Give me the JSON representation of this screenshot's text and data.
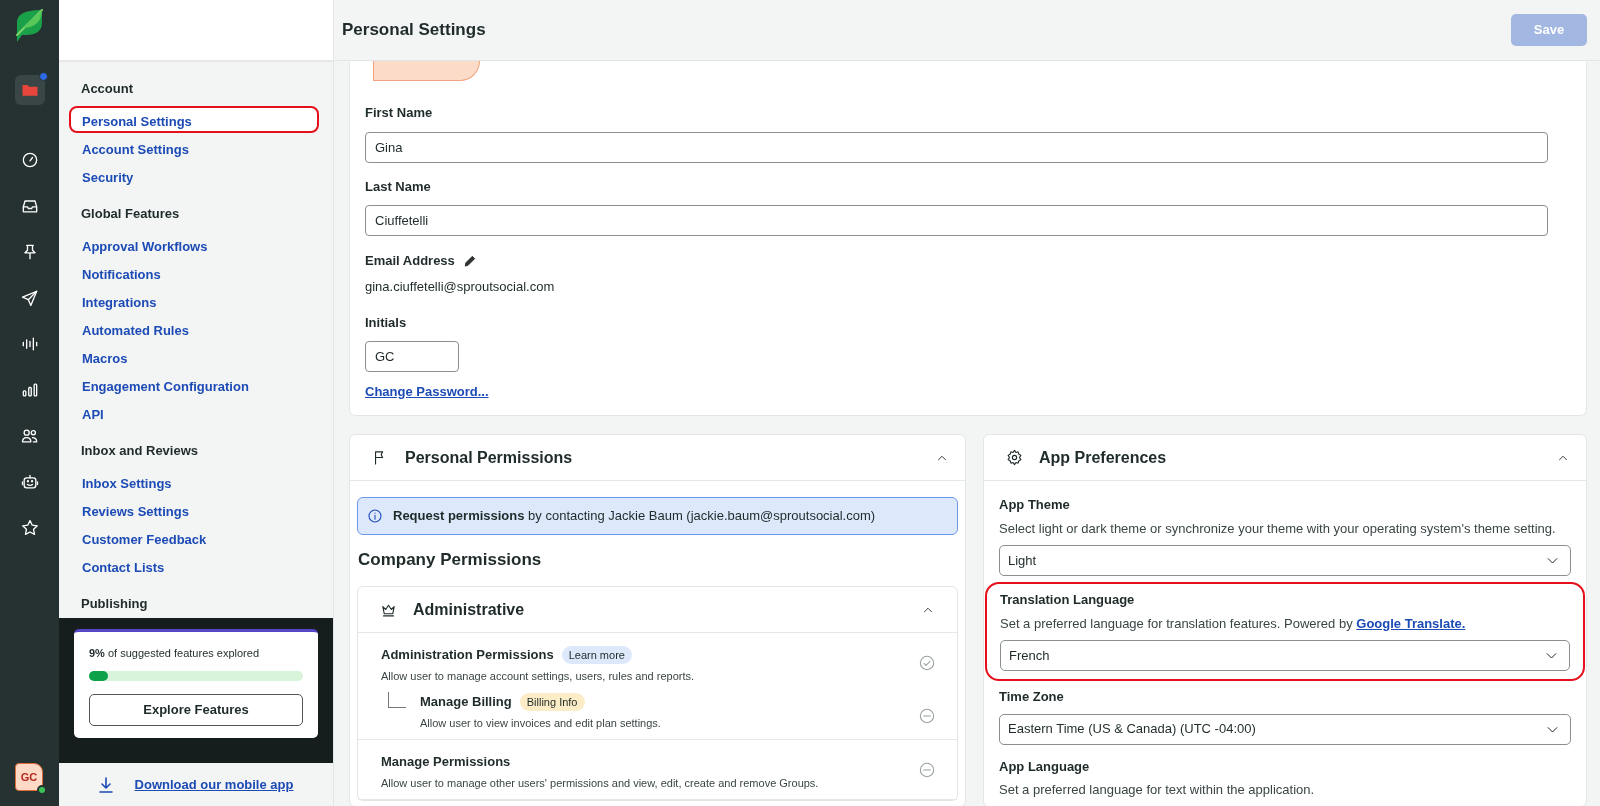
{
  "rail": {
    "items": [
      {
        "selected": true,
        "badge": true
      },
      {
        "selected": false,
        "badge": false
      },
      {
        "selected": false,
        "badge": false
      },
      {
        "selected": false,
        "badge": false
      },
      {
        "selected": false,
        "badge": false
      },
      {
        "selected": false,
        "badge": false
      },
      {
        "selected": false,
        "badge": false
      },
      {
        "selected": false,
        "badge": false
      },
      {
        "selected": false,
        "badge": false
      },
      {
        "selected": false,
        "badge": false
      }
    ],
    "avatar": {
      "initials": "GC",
      "online": true
    }
  },
  "sidebar": {
    "groups": [
      {
        "title": "Account",
        "items": [
          {
            "label": "Personal Settings",
            "selected": true,
            "highlighted": true
          },
          {
            "label": "Account Settings",
            "selected": false,
            "highlighted": false
          },
          {
            "label": "Security",
            "selected": false,
            "highlighted": false
          }
        ]
      },
      {
        "title": "Global Features",
        "items": [
          {
            "label": "Approval Workflows",
            "selected": false,
            "highlighted": false
          },
          {
            "label": "Notifications",
            "selected": false,
            "highlighted": false
          },
          {
            "label": "Integrations",
            "selected": false,
            "highlighted": false
          },
          {
            "label": "Automated Rules",
            "selected": false,
            "highlighted": false
          },
          {
            "label": "Macros",
            "selected": false,
            "highlighted": false
          },
          {
            "label": "Engagement Configuration",
            "selected": false,
            "highlighted": false
          },
          {
            "label": "API",
            "selected": false,
            "highlighted": false
          }
        ]
      },
      {
        "title": "Inbox and Reviews",
        "items": [
          {
            "label": "Inbox Settings",
            "selected": false,
            "highlighted": false
          },
          {
            "label": "Reviews Settings",
            "selected": false,
            "highlighted": false
          },
          {
            "label": "Customer Feedback",
            "selected": false,
            "highlighted": false
          },
          {
            "label": "Contact Lists",
            "selected": false,
            "highlighted": false
          }
        ]
      },
      {
        "title": "Publishing"
      }
    ],
    "progress": {
      "text": "**9%** of suggested features explored",
      "level": 0.09,
      "button": "Explore Features"
    },
    "download": "Download our mobile app"
  },
  "header": {
    "title": "Personal Settings",
    "save": {
      "label": "Save",
      "disabled": true
    }
  },
  "profile": {
    "fields": [
      {
        "label": "First Name",
        "value": "Gina"
      },
      {
        "label": "Last Name",
        "value": "Ciuffetelli"
      }
    ],
    "email": {
      "label": "Email Address",
      "value": "gina.ciuffetelli@sproutsocial.com"
    },
    "initials": {
      "label": "Initials",
      "value": "GC"
    },
    "change_password": "Change Password..."
  },
  "permissions": {
    "title": "Personal Permissions",
    "expanded": true,
    "alert": "**Request permissions** by contacting Jackie Baum (jackie.baum@sproutsocial.com)",
    "company_title": "Company Permissions",
    "group": {
      "title": "Administrative",
      "expanded": true,
      "sections": [
        {
          "title": "Administration Permissions",
          "tag": {
            "label": "Learn more",
            "color": "#dde9fb"
          },
          "description": "Allow user to manage account settings, users, rules and reports.",
          "granted": true,
          "children": [
            {
              "title": "Manage Billing",
              "tag": {
                "label": "Billing Info",
                "color": "#fdedc6"
              },
              "description": "Allow user to view invoices and edit plan settings.",
              "granted": false
            }
          ]
        },
        {
          "title": "Manage Permissions",
          "description": "Allow user to manage other users' permissions and view, edit, create and remove Groups.",
          "granted": false
        }
      ]
    }
  },
  "preferences": {
    "title": "App Preferences",
    "expanded": true,
    "items": [
      {
        "label": "App Theme",
        "description": "Select light or dark theme or synchronize your theme with your operating system's theme setting.",
        "value": "Light",
        "highlighted": false
      },
      {
        "label": "Translation Language",
        "description": "Set a preferred language for translation features. Powered by ",
        "link": "Google Translate.",
        "value": "French",
        "highlighted": true
      },
      {
        "label": "Time Zone",
        "value": "Eastern Time (US & Canada) (UTC -04:00)",
        "highlighted": false
      },
      {
        "label": "App Language",
        "description": "Set a preferred language for text within the application.",
        "highlighted": false
      }
    ]
  }
}
